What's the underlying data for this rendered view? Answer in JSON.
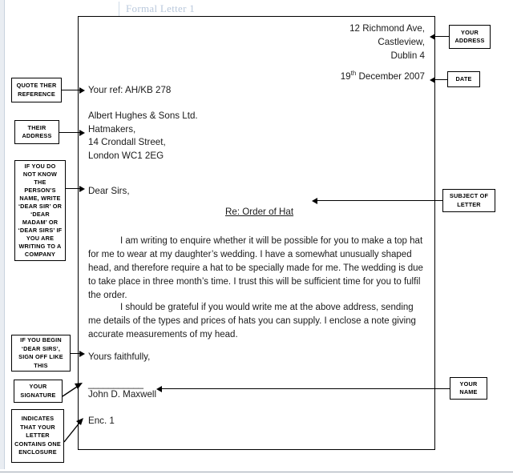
{
  "document": {
    "title": "Formal Letter 1"
  },
  "letter": {
    "sender_address": [
      "12 Richmond Ave,",
      "Castleview,",
      "Dublin 4"
    ],
    "date": {
      "day": "19",
      "ordinal": "th",
      "rest": " December 2007"
    },
    "your_ref": "Your ref: AH/KB 278",
    "recipient_address": [
      "Albert Hughes & Sons Ltd.",
      "Hatmakers,",
      "14 Crondall Street,",
      "London WC1 2EG"
    ],
    "salutation": "Dear Sirs,",
    "subject": "Re: Order of Hat",
    "paragraphs": [
      "I am writing to enquire whether it will be possible for you to make a top hat for me to wear at my daughter’s wedding. I have a somewhat unusually shaped head, and therefore require a hat to be specially made for me. The wedding is due to take place in three month’s time. I trust this will be sufficient time for you to fulfil the order.",
      "I should be grateful if you would write me at the above address, sending me details of the types and prices of hats you can supply. I enclose a note giving accurate measurements of my head."
    ],
    "signoff": "Yours faithfully,",
    "signature_line": "___________",
    "signer": "John D. Maxwell",
    "enclosure": "Enc. 1"
  },
  "annotations": {
    "your_address": "YOUR ADDRESS",
    "date": "DATE",
    "quote_their_reference": "QUOTE THER REFERENCE",
    "their_address": "THEIR ADDRESS",
    "salutation_note": "IF YOU DO NOT KNOW THE PERSON’S NAME, WRITE ‘DEAR SIR’ OR ‘DEAR MADAM’ OR ‘DEAR SIRS’ IF YOU ARE WRITING TO A COMPANY",
    "subject_of_letter": "SUBJECT OF LETTER",
    "signoff_note": "IF YOU BEGIN ‘DEAR SIRS’, SIGN OFF LIKE THIS",
    "your_signature": "YOUR SIGNATURE",
    "your_name": "YOUR NAME",
    "enclosure_note": "INDICATES THAT YOUR LETTER CONTAINS ONE ENCLOSURE"
  },
  "colors": {
    "title": "#b9c8dc",
    "ink": "#1a1a1a",
    "rule": "#9aa3ae"
  }
}
